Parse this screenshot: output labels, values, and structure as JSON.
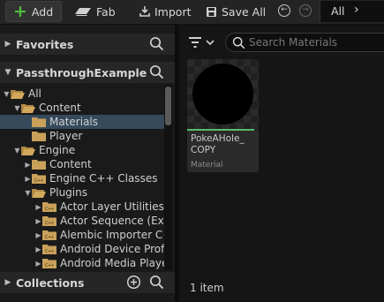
{
  "toolbar": {
    "add_label": "Add",
    "fab_label": "Fab",
    "import_label": "Import",
    "save_all_label": "Save All",
    "path_root": "All"
  },
  "sources": {
    "favorites_title": "Favorites",
    "project_title": "PassthroughExample",
    "collections_title": "Collections",
    "tree": [
      {
        "label": "All",
        "depth": 0,
        "expanded": true,
        "kind": "folder-open"
      },
      {
        "label": "Content",
        "depth": 1,
        "expanded": true,
        "kind": "folder-open"
      },
      {
        "label": "Materials",
        "depth": 2,
        "expanded": false,
        "kind": "folder",
        "selected": true
      },
      {
        "label": "Player",
        "depth": 2,
        "expanded": false,
        "kind": "folder"
      },
      {
        "label": "Engine",
        "depth": 1,
        "expanded": true,
        "kind": "folder-open"
      },
      {
        "label": "Content",
        "depth": 2,
        "expanded": false,
        "kind": "folder",
        "collapsed": true
      },
      {
        "label": "Engine C++ Classes",
        "depth": 2,
        "expanded": false,
        "kind": "code",
        "collapsed": true
      },
      {
        "label": "Plugins",
        "depth": 2,
        "expanded": true,
        "kind": "folder-open"
      },
      {
        "label": "Actor Layer Utilities C",
        "depth": 3,
        "kind": "code",
        "collapsed": true
      },
      {
        "label": "Actor Sequence (Expe",
        "depth": 3,
        "kind": "code",
        "collapsed": true
      },
      {
        "label": "Alembic Importer C++",
        "depth": 3,
        "kind": "code",
        "collapsed": true
      },
      {
        "label": "Android Device Profil",
        "depth": 3,
        "kind": "code",
        "collapsed": true
      },
      {
        "label": "Android Media Player",
        "depth": 3,
        "kind": "code",
        "collapsed": true
      }
    ]
  },
  "assets": {
    "search_placeholder": "Search Materials",
    "items": [
      {
        "name": "PokeAHole_COPY",
        "name_display": "PokeAHole_\nCOPY",
        "type": "Material",
        "type_color": "#55c06a"
      }
    ],
    "count_label": "1 item"
  },
  "colors": {
    "accent_add": "#4fbe3c",
    "selection": "#364a5c",
    "folder": "#c9a15a"
  }
}
